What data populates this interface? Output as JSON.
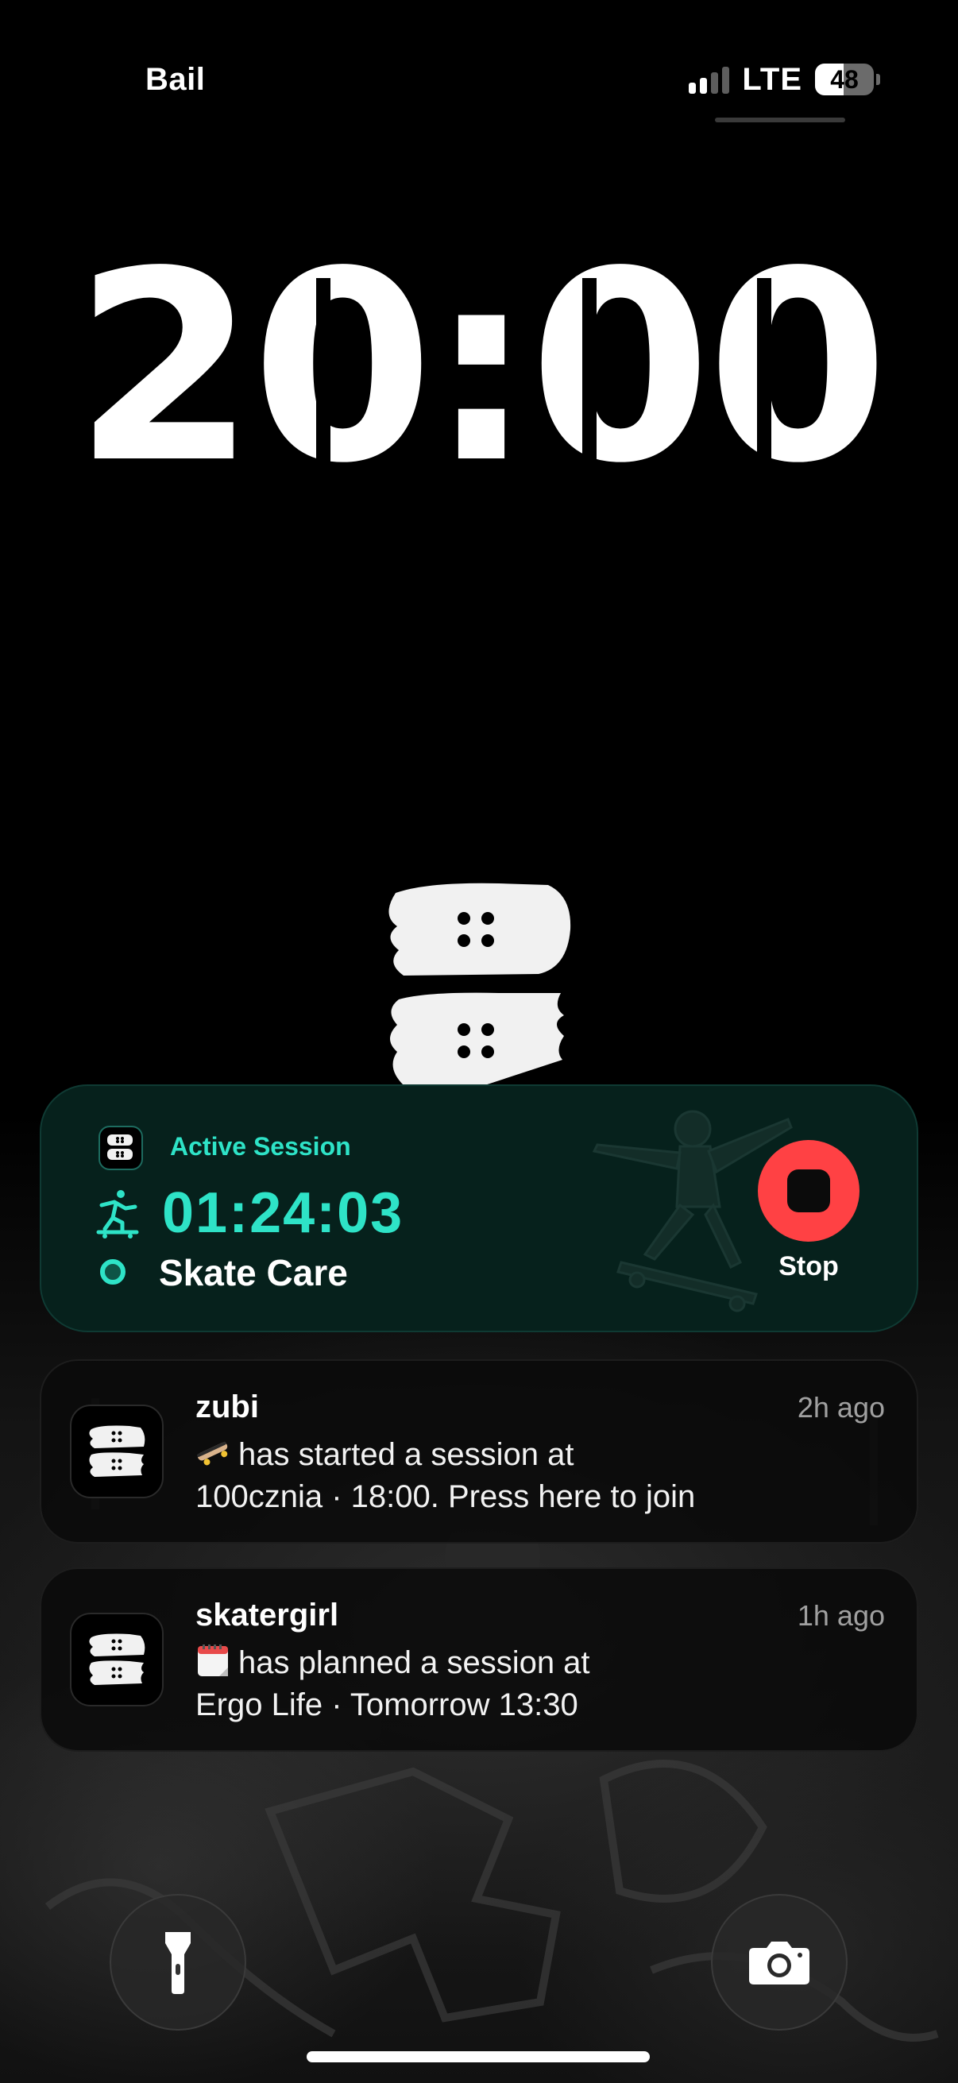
{
  "status_bar": {
    "carrier": "Bail",
    "network": "LTE",
    "battery_level": "48",
    "battery_fraction": 0.48,
    "signal_bars_active": 2,
    "signal_bars_total": 4
  },
  "lock_screen": {
    "time": "20:00"
  },
  "live_activity": {
    "title": "Active Session",
    "elapsed": "01:24:03",
    "spot": "Skate Care",
    "stop_label": "Stop",
    "accent_color": "#2ee3c7",
    "stop_color": "#ff4144"
  },
  "notifications": [
    {
      "user": "zubi",
      "time": "2h ago",
      "emoji": "skateboard-icon",
      "line1": "has started a session at",
      "line2": "100cznia · 18:00. Press here to join"
    },
    {
      "user": "skatergirl",
      "time": "1h ago",
      "emoji": "calendar-icon",
      "line1": "has planned a session at",
      "line2": "Ergo Life · Tomorrow 13:30"
    }
  ],
  "quick_actions": {
    "left": "flashlight-icon",
    "right": "camera-icon"
  }
}
